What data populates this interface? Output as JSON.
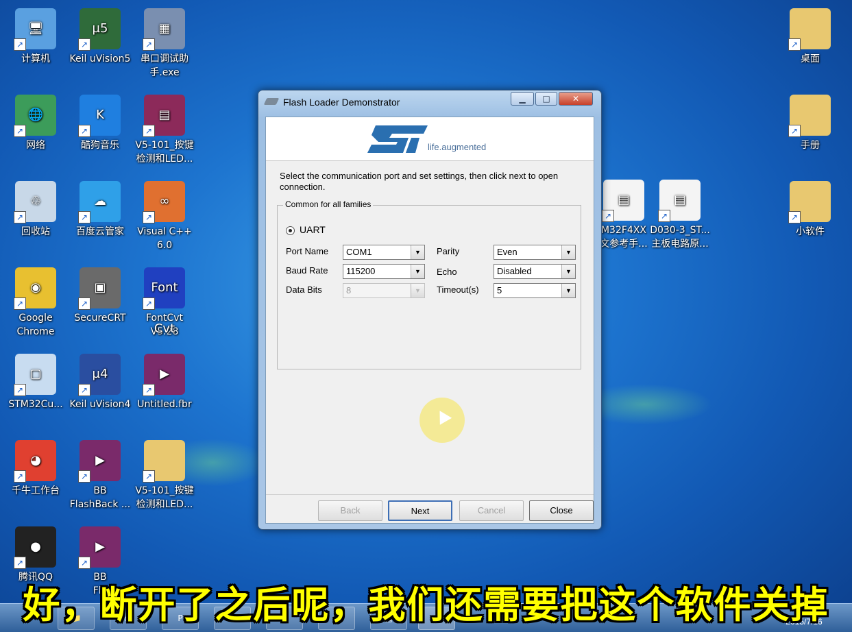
{
  "desktop": {
    "icons_left": [
      {
        "label": "计算机",
        "icon": "computer-icon"
      },
      {
        "label": "Keil uVision5",
        "icon": "keil-uvision5-icon"
      },
      {
        "label": "串口调试助\n手.exe",
        "icon": "serial-tool-icon"
      },
      {
        "label": "网络",
        "icon": "network-icon"
      },
      {
        "label": "酷狗音乐",
        "icon": "kugou-icon"
      },
      {
        "label": "V5-101_按键\n检测和LED...",
        "icon": "rar-archive-icon"
      },
      {
        "label": "回收站",
        "icon": "recycle-bin-icon"
      },
      {
        "label": "百度云管家",
        "icon": "baidu-cloud-icon"
      },
      {
        "label": "Visual C++\n6.0",
        "icon": "visual-cpp-icon"
      },
      {
        "label": "Google\nChrome",
        "icon": "chrome-icon"
      },
      {
        "label": "SecureCRT",
        "icon": "securecrt-icon"
      },
      {
        "label": "FontCvt\nV5.28",
        "icon": "fontcvt-icon"
      },
      {
        "label": "STM32Cu...",
        "icon": "stm32cube-icon"
      },
      {
        "label": "Keil uVision4",
        "icon": "keil-uvision4-icon"
      },
      {
        "label": "Untitled.fbr",
        "icon": "fbr-file-icon"
      },
      {
        "label": "千牛工作台",
        "icon": "qianniu-icon"
      },
      {
        "label": "BB\nFlashBack ...",
        "icon": "bb-flashback-icon"
      },
      {
        "label": "V5-101_按键\n检测和LED...",
        "icon": "folder-icon"
      },
      {
        "label": "腾讯QQ",
        "icon": "qq-icon"
      },
      {
        "label": "BB\nFla",
        "icon": "bb-flashback-icon"
      }
    ],
    "icons_right": [
      {
        "label": "桌面",
        "icon": "folder-icon"
      },
      {
        "label": "手册",
        "icon": "folder-icon"
      },
      {
        "label": "小软件",
        "icon": "folder-icon"
      }
    ],
    "icons_middle": [
      {
        "label": "M32F4XX\n文参考手...",
        "icon": "pdf-doc-icon"
      },
      {
        "label": "D030-3_ST...\n主板电路原...",
        "icon": "pdf-doc-icon"
      }
    ]
  },
  "dialog": {
    "title": "Flash Loader Demonstrator",
    "controls": {
      "minimize": "▁",
      "maximize": "□",
      "close": "✕"
    },
    "tagline": "life.augmented",
    "instructions": "Select the communication port and set settings, then click next to open connection.",
    "group_title": "Common for all families",
    "radio_label": "UART",
    "fields": {
      "port_name": {
        "label": "Port Name",
        "value": "COM1"
      },
      "baud_rate": {
        "label": "Baud Rate",
        "value": "115200"
      },
      "data_bits": {
        "label": "Data Bits",
        "value": "8"
      },
      "parity": {
        "label": "Parity",
        "value": "Even"
      },
      "echo": {
        "label": "Echo",
        "value": "Disabled"
      },
      "timeout": {
        "label": "Timeout(s)",
        "value": "5"
      }
    },
    "buttons": {
      "back": "Back",
      "next": "Next",
      "cancel": "Cancel",
      "close": "Close"
    }
  },
  "taskbar": {
    "clock_time": "12:9",
    "clock_date": "2015/7/16"
  },
  "subtitle": "好，断开了之后呢，我们还需要把这个软件关掉"
}
